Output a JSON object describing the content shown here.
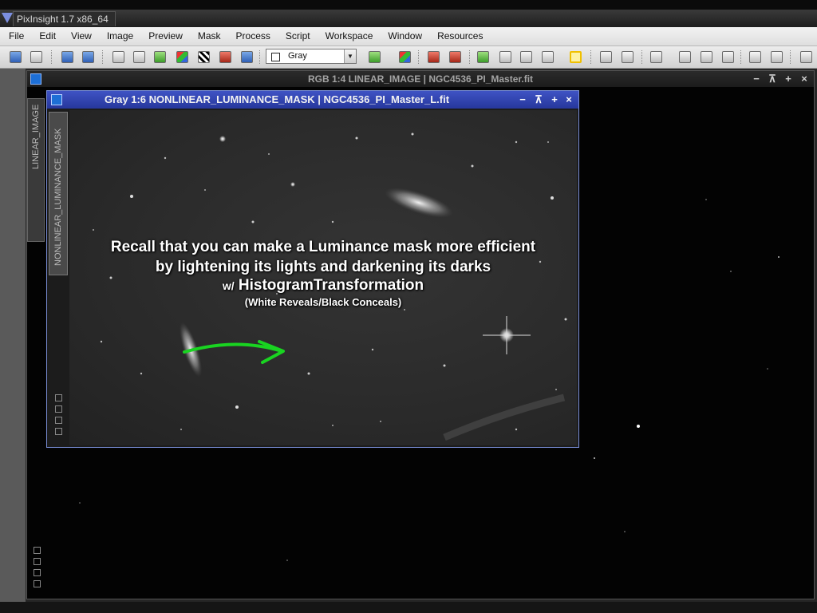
{
  "app": {
    "title": "PixInsight 1.7 x86_64"
  },
  "menu": [
    "File",
    "Edit",
    "View",
    "Image",
    "Preview",
    "Mask",
    "Process",
    "Script",
    "Workspace",
    "Window",
    "Resources"
  ],
  "toolbar": {
    "mask_mode_dropdown": "Gray"
  },
  "rgb_window": {
    "title": "RGB 1:4 LINEAR_IMAGE | NGC4536_PI_Master.fit",
    "side_tab": "LINEAR_IMAGE",
    "controls": [
      "−",
      "⊼",
      "+",
      "×"
    ]
  },
  "mask_window": {
    "title": "Gray 1:6 NONLINEAR_LUMINANCE_MASK | NGC4536_PI_Master_L.fit",
    "side_tab": "NONLINEAR_LUMINANCE_MASK",
    "controls": [
      "−",
      "⊼",
      "+",
      "×"
    ]
  },
  "overlay": {
    "line1": "Recall that you can make a Luminance mask more efficient",
    "line2": "by lightening its lights and darkening its darks",
    "line3_prefix": "w/",
    "line3": "HistogramTransformation",
    "line4": "(White Reveals/Black Conceals)"
  },
  "colors": {
    "mask_title_bar": "#2f44b0",
    "annotation_arrow": "#19d421",
    "background": "#030303"
  }
}
